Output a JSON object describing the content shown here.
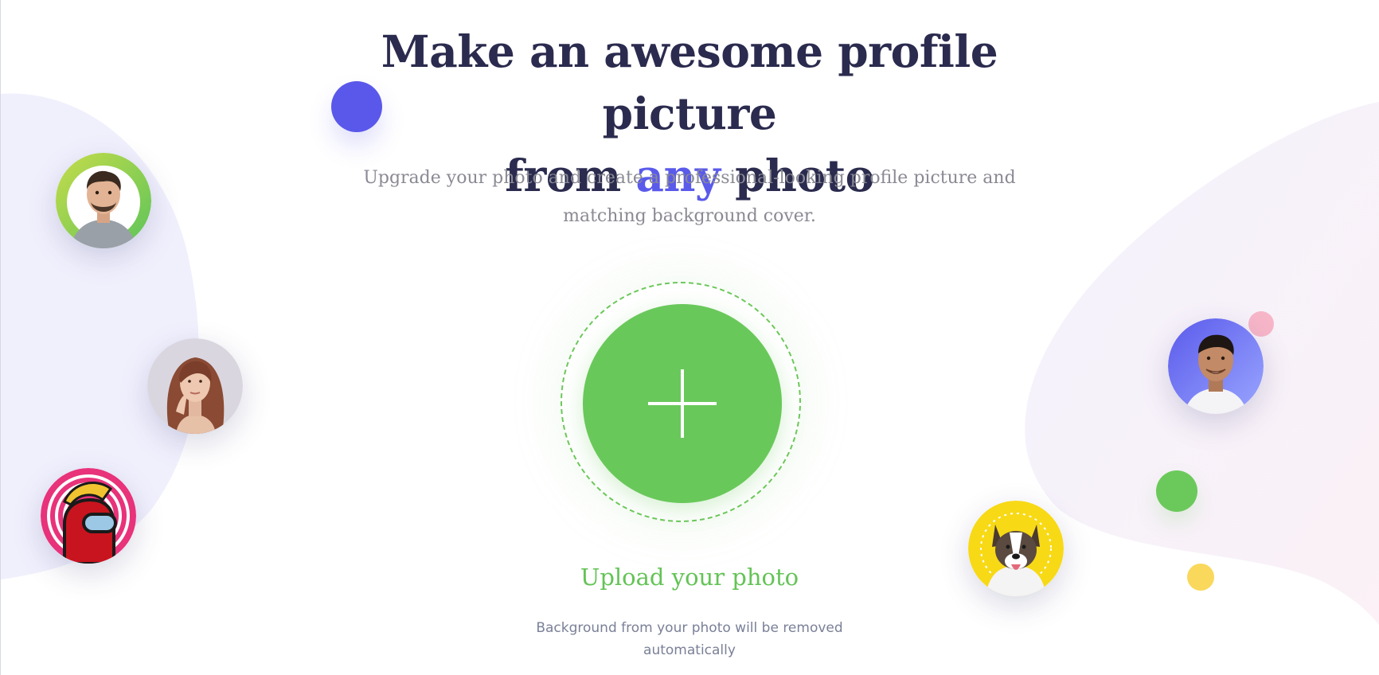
{
  "hero": {
    "title_part1": "Make an awesome profile picture",
    "title_part2": "from",
    "title_accent": "any",
    "title_part3": "photo",
    "subtitle": "Upgrade your photo and create a professional-looking profile picture and matching background cover."
  },
  "upload": {
    "title": "Upload your photo",
    "note": "Background from your photo will be removed automatically"
  },
  "examples": [
    {
      "name": "man-avatar"
    },
    {
      "name": "woman-avatar"
    },
    {
      "name": "game-character-avatar"
    },
    {
      "name": "smiling-man-avatar"
    },
    {
      "name": "dog-avatar"
    }
  ],
  "colors": {
    "heading": "#2b2b4f",
    "accent": "#5a5aeb",
    "upload_green": "#69c85a",
    "text_muted": "#8a8a94"
  },
  "icons": {
    "upload": "plus-icon"
  }
}
